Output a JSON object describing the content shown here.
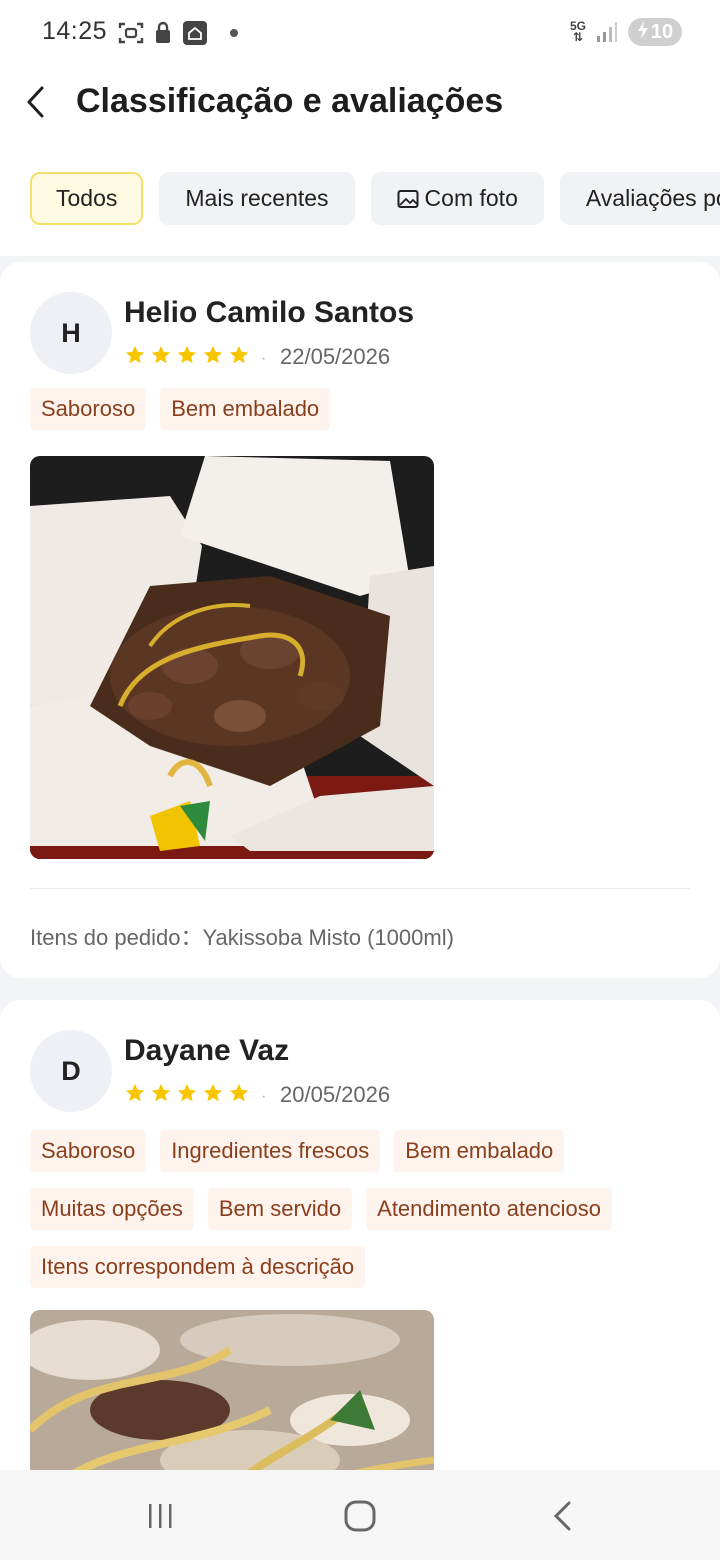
{
  "status_bar": {
    "time": "14:25",
    "network": "5G",
    "battery": "10",
    "icons": [
      "screenshot-icon",
      "lock-icon",
      "home-app-icon",
      "notification-dot-icon",
      "signal-icon",
      "charging-icon"
    ]
  },
  "header": {
    "title": "Classificação e avaliações",
    "back_icon": "chevron-left-icon"
  },
  "filters": {
    "all": "Todos",
    "recent": "Mais recentes",
    "with_photo": "Com foto",
    "by_rating": "Avaliações po"
  },
  "reviews": [
    {
      "avatar_initial": "H",
      "name": "Helio Camilo Santos",
      "rating": 5,
      "date": "22/05/2026",
      "tags": [
        "Saboroso",
        "Bem embalado"
      ],
      "order_items": "Itens do pedido：Yakissoba Misto (1000ml)"
    },
    {
      "avatar_initial": "D",
      "name": "Dayane Vaz",
      "rating": 5,
      "date": "20/05/2026",
      "tags": [
        "Saboroso",
        "Ingredientes frescos",
        "Bem embalado",
        "Muitas opções",
        "Bem servido",
        "Atendimento atencioso",
        "Itens correspondem à descrição"
      ]
    }
  ],
  "colors": {
    "star": "#f7c600",
    "tag_bg": "#fff3ee",
    "tag_text": "#8a3f1c",
    "active_chip_bg": "#fffbe3",
    "active_chip_border": "#f5de6a"
  },
  "nav": {
    "icons": [
      "recent-apps-icon",
      "home-icon",
      "back-icon"
    ]
  }
}
